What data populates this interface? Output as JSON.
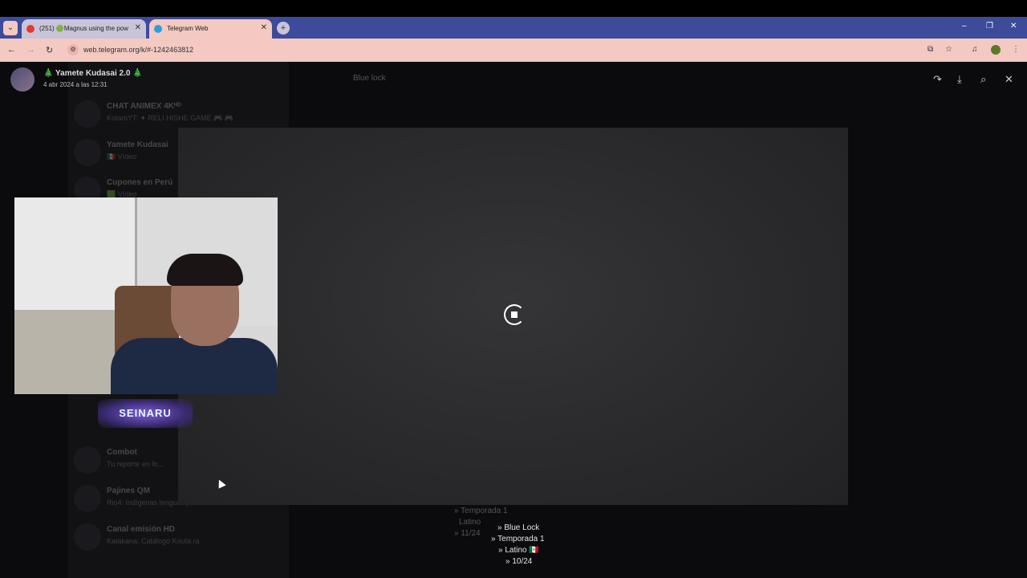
{
  "browser": {
    "tabs": [
      {
        "title": "(251) 🟢Magnus using the pow",
        "favicon_color": "#e53935",
        "active": false
      },
      {
        "title": "Telegram Web",
        "favicon_color": "#2aa1da",
        "active": true
      }
    ],
    "new_tab": "+",
    "menu_icon": "chevron-down-icon",
    "window_controls": {
      "minimize": "–",
      "restore": "❐",
      "close": "✕"
    },
    "url": "web.telegram.org/k/#-1242463812",
    "nav": {
      "back": "←",
      "forward": "→",
      "reload": "↻"
    },
    "site_info": "⚙",
    "toolbar_icons": {
      "install": "⧉",
      "bookmark": "☆",
      "media": "♫",
      "more": "⋮"
    }
  },
  "viewer": {
    "sender_name": "🎄 Yamete Kudasai 2.0 🎄",
    "sender_date": "4 abr 2024 a las 12:31",
    "actions": {
      "forward": "↷",
      "download": "⤓",
      "zoom": "⌕",
      "close": "✕"
    }
  },
  "background_chat": {
    "search_text": "Blue lock",
    "chats": [
      {
        "name": "CHAT ANIMEX 4Kᴴᴰ",
        "preview": "KotamYT: ✦ RELI HISHE GAME 🎮 🎮"
      },
      {
        "name": "Yamete Kudasai",
        "preview": "🇲🇽 Vídeo"
      },
      {
        "name": "Cupones en Perú",
        "preview": "🟩 Vídeo"
      },
      {
        "name": "Combot",
        "preview": "Tu reporte en lo..."
      },
      {
        "name": "Pajines QM",
        "preview": "Rio4: Indígenas lenguas primera"
      },
      {
        "name": "Canal emisión HD",
        "preview": "Katakana: Catálogo Kouta ra"
      }
    ]
  },
  "caption_lines": [
    {
      "text": "» Temporada 1",
      "bright": false
    },
    {
      "text": "Latino",
      "bright": false
    },
    {
      "text": "» 11/24",
      "bright": false
    },
    {
      "text": "» Blue Lock",
      "bright": true
    },
    {
      "text": "» Temporada 1",
      "bright": true
    },
    {
      "text": "» Latino 🇲🇽",
      "bright": true
    },
    {
      "text": "» 10/24",
      "bright": true
    }
  ],
  "overlay_logo": "SEINARU",
  "media_state": "loading"
}
